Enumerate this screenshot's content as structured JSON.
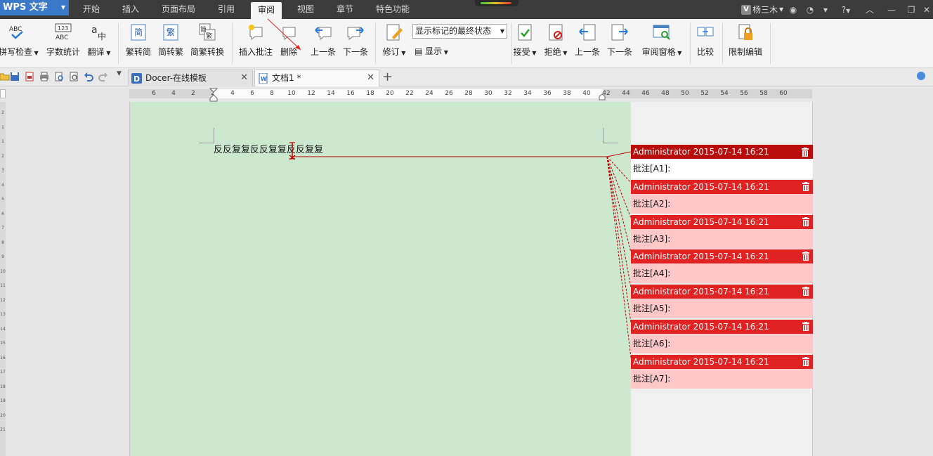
{
  "app": {
    "name": "WPS 文字",
    "menu_tabs": [
      "开始",
      "插入",
      "页面布局",
      "引用",
      "审阅",
      "视图",
      "章节",
      "特色功能"
    ],
    "active_tab": "审阅",
    "user_name": "杨三木",
    "user_badge": "V",
    "help_label": "?"
  },
  "ribbon": {
    "spellcheck": "拼写检查",
    "word_count": "字数统计",
    "translate": "翻译",
    "trad_to_simp": "繁转简",
    "simp_to_trad": "简转繁",
    "conversion": "简繁转换",
    "insert_comment": "插入批注",
    "delete": "删除",
    "prev_comment": "上一条",
    "next_comment": "下一条",
    "revise": "修订",
    "markup_state": "显示标记的最终状态",
    "show": "显示",
    "accept": "接受",
    "reject": "拒绝",
    "prev_change": "上一条",
    "next_change": "下一条",
    "review_pane": "审阅窗格",
    "compare": "比较",
    "restrict_edit": "限制编辑",
    "icon_abc": "ABC",
    "icon_123": "123",
    "icon_simp": "简",
    "icon_trad": "繁",
    "icon_zhong": "中"
  },
  "doc_tabs": [
    {
      "label": "Docer-在线模板",
      "close": "✕"
    },
    {
      "label": "文档1 *",
      "close": "✕"
    }
  ],
  "new_tab": "+",
  "ruler": {
    "labels": [
      "6",
      "4",
      "2",
      "2",
      "4",
      "6",
      "8",
      "10",
      "12",
      "14",
      "16",
      "18",
      "20",
      "22",
      "24",
      "26",
      "28",
      "30",
      "32",
      "34",
      "36",
      "38",
      "40",
      "42",
      "44",
      "46",
      "48",
      "50",
      "52",
      "54",
      "56",
      "58",
      "60"
    ],
    "vlabels": [
      "2",
      "1",
      "1",
      "2",
      "3",
      "4",
      "5",
      "6",
      "7",
      "8",
      "9",
      "10",
      "11",
      "12",
      "13",
      "14",
      "15",
      "16",
      "17",
      "18",
      "19",
      "20",
      "21"
    ]
  },
  "document": {
    "text": "反反复复反反复复反反复复"
  },
  "comments": [
    {
      "author_time": "Administrator 2015-07-14 16:21",
      "body": "批注[A1]:",
      "active": true
    },
    {
      "author_time": "Administrator 2015-07-14 16:21",
      "body": "批注[A2]:"
    },
    {
      "author_time": "Administrator 2015-07-14 16:21",
      "body": "批注[A3]:"
    },
    {
      "author_time": "Administrator 2015-07-14 16:21",
      "body": "批注[A4]:"
    },
    {
      "author_time": "Administrator 2015-07-14 16:21",
      "body": "批注[A5]:"
    },
    {
      "author_time": "Administrator 2015-07-14 16:21",
      "body": "批注[A6]:"
    },
    {
      "author_time": "Administrator 2015-07-14 16:21",
      "body": "批注[A7]:"
    }
  ],
  "colors": {
    "comment_header": "#e02222",
    "comment_header_active": "#b90d0d",
    "comment_body": "#ffc8c8",
    "page_background": "#cce8cf",
    "app_button": "#3a78c9"
  }
}
